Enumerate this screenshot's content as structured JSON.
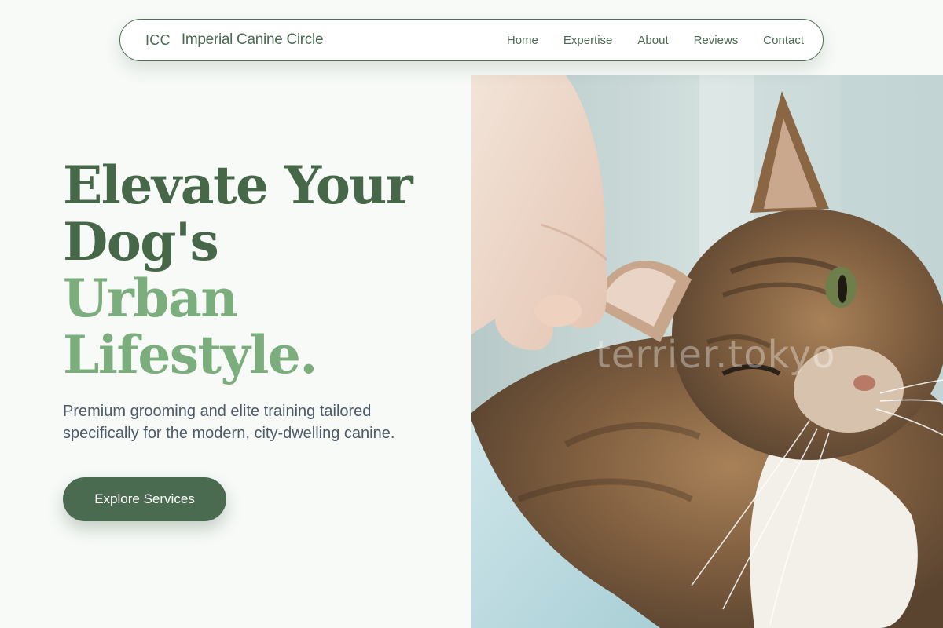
{
  "brand": {
    "mark": "ICC",
    "name": "Imperial Canine Circle"
  },
  "nav": {
    "links": [
      "Home",
      "Expertise",
      "About",
      "Reviews",
      "Contact"
    ]
  },
  "hero": {
    "headline_dark": [
      "Elevate Your",
      "Dog's"
    ],
    "headline_light": [
      "Urban",
      "Lifestyle."
    ],
    "subtitle": "Premium grooming and elite training tailored specifically for the modern, city-dwelling canine.",
    "cta_label": "Explore Services",
    "image": {
      "subject": "tabby cat having its ear gently held by a hand",
      "watermark": "terrier.tokyo"
    }
  },
  "colors": {
    "page_background": "#f7faf7",
    "brand_green": "#4a6b50",
    "headline_dark": "#466849",
    "headline_light": "#7cae7d",
    "body_text": "#4d5a6a"
  }
}
